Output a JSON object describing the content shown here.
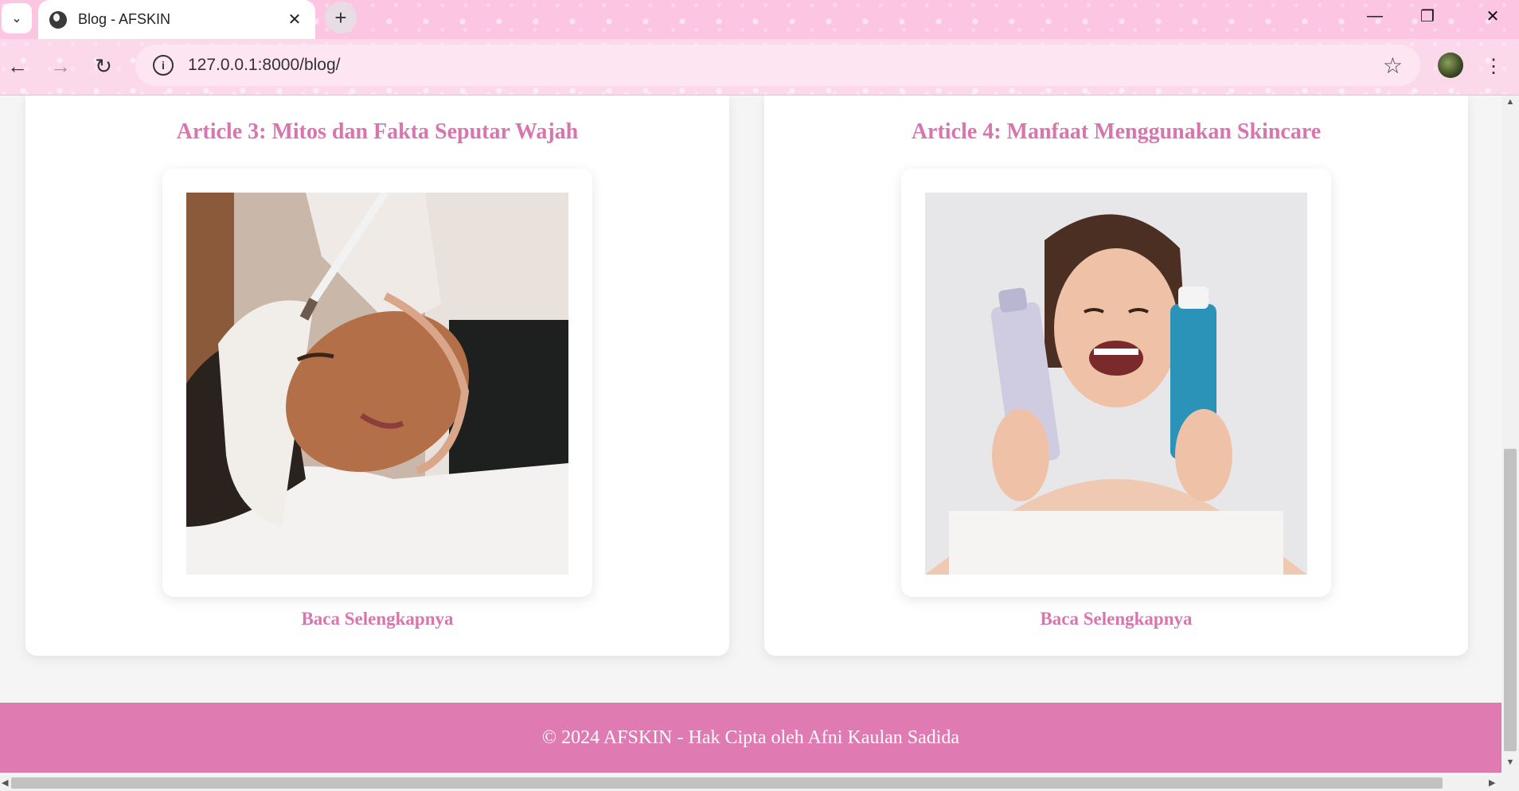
{
  "browser": {
    "tab_title": "Blog - AFSKIN",
    "url": "127.0.0.1:8000/blog/"
  },
  "articles": [
    {
      "title": "Article 3: Mitos dan Fakta Seputar Wajah",
      "link_label": "Baca Selengkapnya"
    },
    {
      "title": "Article 4: Manfaat Menggunakan Skincare",
      "link_label": "Baca Selengkapnya"
    }
  ],
  "footer": {
    "text": "© 2024 AFSKIN - Hak Cipta oleh Afni Kaulan Sadida"
  },
  "colors": {
    "accent": "#d874ae",
    "footer_bg": "#df7ab2",
    "chrome_pink": "#fcc5e2"
  }
}
